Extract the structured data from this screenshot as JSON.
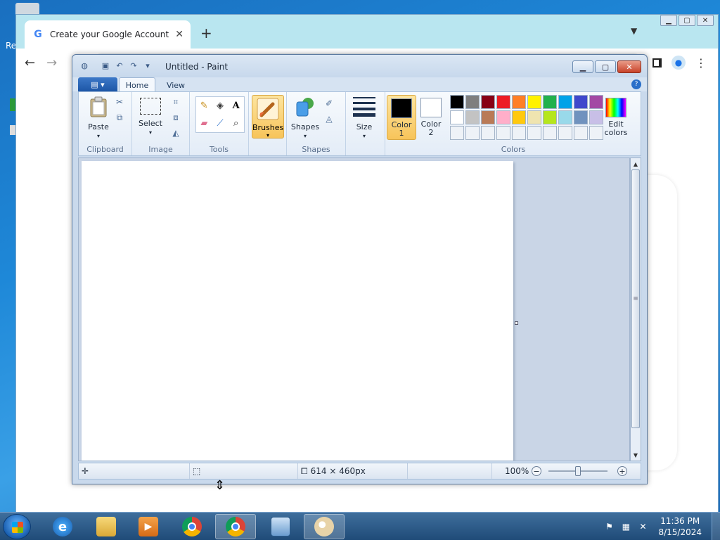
{
  "desktop": {
    "label_fragment": "Re"
  },
  "chrome": {
    "tab_title": "Create your Google Account",
    "tab_icon_glyph": "G",
    "tab_close": "✕",
    "new_tab": "+",
    "tab_list": "⌄"
  },
  "paint": {
    "title": "Untitled - Paint",
    "tabs": {
      "home": "Home",
      "view": "View"
    },
    "groups": {
      "clipboard": {
        "label": "Clipboard",
        "paste": "Paste"
      },
      "image": {
        "label": "Image",
        "select": "Select"
      },
      "tools": {
        "label": "Tools"
      },
      "brushes": {
        "label": "Brushes"
      },
      "shapes": {
        "label": "Shapes",
        "shapes_btn": "Shapes"
      },
      "size": {
        "label": "Size"
      },
      "colors": {
        "label": "Colors",
        "color1": "Color\n1",
        "color1_line1": "Color",
        "color1_line2": "1",
        "color2_line1": "Color",
        "color2_line2": "2",
        "edit_line1": "Edit",
        "edit_line2": "colors",
        "color1_value": "#000000",
        "color2_value": "#ffffff",
        "palette_row1": [
          "#000000",
          "#7f7f7f",
          "#880015",
          "#ed1c24",
          "#ff7f27",
          "#fff200",
          "#22b14c",
          "#00a2e8",
          "#3f48cc",
          "#a349a4"
        ],
        "palette_row2": [
          "#ffffff",
          "#c3c3c3",
          "#b97a57",
          "#ffaec9",
          "#ffc90e",
          "#efe4b0",
          "#b5e61d",
          "#99d9ea",
          "#7092be",
          "#c8bfe7"
        ]
      }
    },
    "status": {
      "dimensions": "614 × 460px",
      "zoom": "100%"
    }
  },
  "taskbar": {
    "time": "11:36 PM",
    "date": "8/15/2024"
  }
}
